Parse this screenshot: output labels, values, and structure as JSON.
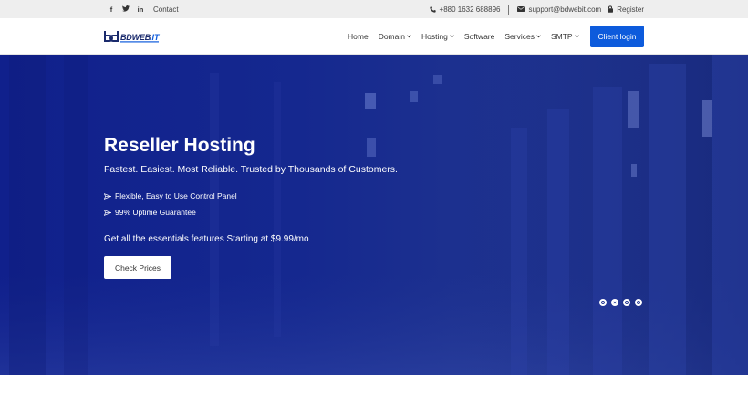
{
  "topbar": {
    "social": [
      {
        "icon": "facebook-icon",
        "glyph": "f"
      },
      {
        "icon": "twitter-icon",
        "glyph": "t"
      },
      {
        "icon": "linkedin-icon",
        "glyph": "in"
      }
    ],
    "contact_label": "Contact",
    "phone": "+880 1632 688896",
    "email": "support@bdwebit.com",
    "register_label": "Register"
  },
  "navbar": {
    "logo_text": "BDWEB.IT",
    "items": [
      {
        "label": "Home",
        "dropdown": false
      },
      {
        "label": "Domain",
        "dropdown": true
      },
      {
        "label": "Hosting",
        "dropdown": true
      },
      {
        "label": "Software",
        "dropdown": false
      },
      {
        "label": "Services",
        "dropdown": true
      },
      {
        "label": "SMTP",
        "dropdown": true
      }
    ],
    "client_login_label": "Client login"
  },
  "hero": {
    "title": "Reseller Hosting",
    "subtitle": "Fastest. Easiest. Most Reliable. Trusted by Thousands of Customers.",
    "features": [
      "Flexible, Easy to Use Control Panel",
      "99% Uptime Guarantee"
    ],
    "essentials": "Get all the essentials features Starting at $9.99/mo",
    "cta_label": "Check Prices",
    "slides": 4,
    "active_slide": 2
  },
  "colors": {
    "primary": "#0d5bdc",
    "hero": "#15288f",
    "topbar": "#eeeeee"
  }
}
